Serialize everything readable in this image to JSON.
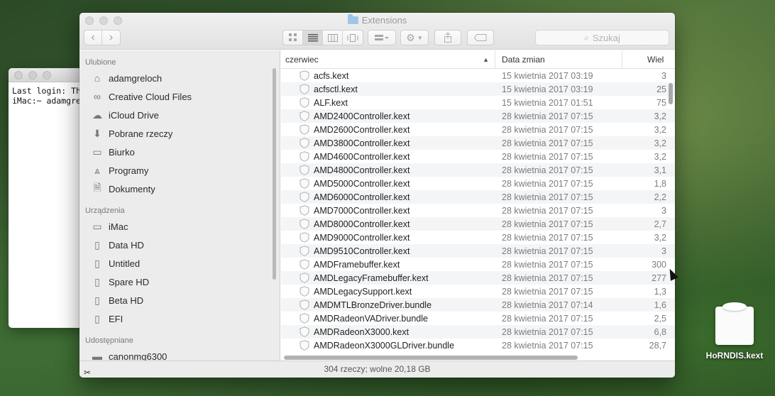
{
  "terminal": {
    "lines": [
      "Last login: Th",
      "iMac:~ adamgre"
    ]
  },
  "finder": {
    "title": "Extensions",
    "search_placeholder": "Szukaj",
    "sidebar": {
      "favorites_header": "Ulubione",
      "favorites": [
        {
          "label": "adamgreloch",
          "icon": "home-icon"
        },
        {
          "label": "Creative Cloud Files",
          "icon": "creative-cloud-icon"
        },
        {
          "label": "iCloud Drive",
          "icon": "cloud-icon"
        },
        {
          "label": "Pobrane rzeczy",
          "icon": "download-icon"
        },
        {
          "label": "Biurko",
          "icon": "desktop-icon"
        },
        {
          "label": "Programy",
          "icon": "applications-icon"
        },
        {
          "label": "Dokumenty",
          "icon": "documents-icon"
        }
      ],
      "devices_header": "Urządzenia",
      "devices": [
        {
          "label": "iMac",
          "icon": "imac-icon"
        },
        {
          "label": "Data HD",
          "icon": "disk-icon"
        },
        {
          "label": "Untitled",
          "icon": "disk-icon"
        },
        {
          "label": "Spare HD",
          "icon": "disk-icon"
        },
        {
          "label": "Beta HD",
          "icon": "disk-icon"
        },
        {
          "label": "EFI",
          "icon": "disk-icon"
        }
      ],
      "shared_header": "Udostępniane",
      "shared": [
        {
          "label": "canonmg6300",
          "icon": "printer-icon"
        }
      ]
    },
    "columns": {
      "name": "czerwiec",
      "date": "Data zmian",
      "size": "Wiel"
    },
    "rows": [
      {
        "name": "acfs.kext",
        "date": "15 kwietnia 2017 03:19",
        "size": "3"
      },
      {
        "name": "acfsctl.kext",
        "date": "15 kwietnia 2017 03:19",
        "size": "25"
      },
      {
        "name": "ALF.kext",
        "date": "15 kwietnia 2017 01:51",
        "size": "75"
      },
      {
        "name": "AMD2400Controller.kext",
        "date": "28 kwietnia 2017 07:15",
        "size": "3,2"
      },
      {
        "name": "AMD2600Controller.kext",
        "date": "28 kwietnia 2017 07:15",
        "size": "3,2"
      },
      {
        "name": "AMD3800Controller.kext",
        "date": "28 kwietnia 2017 07:15",
        "size": "3,2"
      },
      {
        "name": "AMD4600Controller.kext",
        "date": "28 kwietnia 2017 07:15",
        "size": "3,2"
      },
      {
        "name": "AMD4800Controller.kext",
        "date": "28 kwietnia 2017 07:15",
        "size": "3,1"
      },
      {
        "name": "AMD5000Controller.kext",
        "date": "28 kwietnia 2017 07:15",
        "size": "1,8"
      },
      {
        "name": "AMD6000Controller.kext",
        "date": "28 kwietnia 2017 07:15",
        "size": "2,2"
      },
      {
        "name": "AMD7000Controller.kext",
        "date": "28 kwietnia 2017 07:15",
        "size": "3"
      },
      {
        "name": "AMD8000Controller.kext",
        "date": "28 kwietnia 2017 07:15",
        "size": "2,7"
      },
      {
        "name": "AMD9000Controller.kext",
        "date": "28 kwietnia 2017 07:15",
        "size": "3,2"
      },
      {
        "name": "AMD9510Controller.kext",
        "date": "28 kwietnia 2017 07:15",
        "size": "3"
      },
      {
        "name": "AMDFramebuffer.kext",
        "date": "28 kwietnia 2017 07:15",
        "size": "300"
      },
      {
        "name": "AMDLegacyFramebuffer.kext",
        "date": "28 kwietnia 2017 07:15",
        "size": "277"
      },
      {
        "name": "AMDLegacySupport.kext",
        "date": "28 kwietnia 2017 07:15",
        "size": "1,3"
      },
      {
        "name": "AMDMTLBronzeDriver.bundle",
        "date": "28 kwietnia 2017 07:14",
        "size": "1,6"
      },
      {
        "name": "AMDRadeonVADriver.bundle",
        "date": "28 kwietnia 2017 07:15",
        "size": "2,5"
      },
      {
        "name": "AMDRadeonX3000.kext",
        "date": "28 kwietnia 2017 07:15",
        "size": "6,8"
      },
      {
        "name": "AMDRadeonX3000GLDriver.bundle",
        "date": "28 kwietnia 2017 07:15",
        "size": "28,7"
      }
    ],
    "status": "304 rzeczy; wolne 20,18 GB"
  },
  "desktop_icon": {
    "label": "HoRNDIS.kext"
  }
}
